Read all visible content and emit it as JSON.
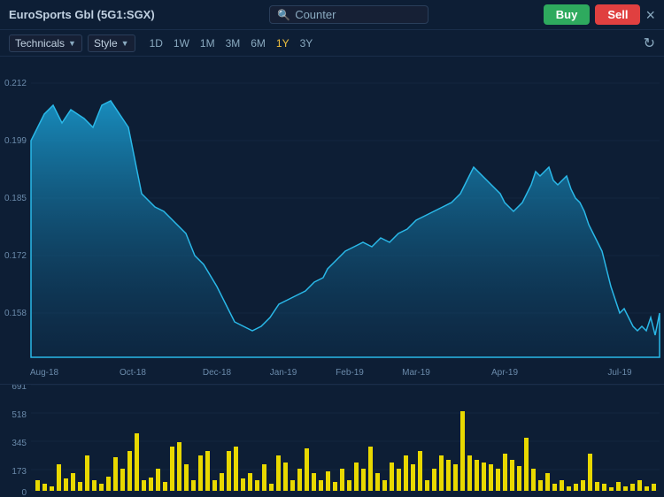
{
  "header": {
    "title": "EuroSports Gbl (5G1:SGX)",
    "search_placeholder": "Counter",
    "buy_label": "Buy",
    "sell_label": "Sell",
    "close_label": "×"
  },
  "toolbar": {
    "technicals_label": "Technicals",
    "style_label": "Style",
    "timeframes": [
      {
        "label": "1D",
        "active": false
      },
      {
        "label": "1W",
        "active": false
      },
      {
        "label": "1M",
        "active": false
      },
      {
        "label": "3M",
        "active": false
      },
      {
        "label": "6M",
        "active": false
      },
      {
        "label": "1Y",
        "active": true
      },
      {
        "label": "3Y",
        "active": false
      }
    ],
    "refresh_icon": "↻"
  },
  "chart": {
    "y_labels": [
      "0.212",
      "0.199",
      "0.185",
      "0.172",
      "0.158"
    ],
    "x_labels": [
      "Aug-18",
      "Oct-18",
      "Dec-18",
      "Jan-19",
      "Feb-19",
      "Mar-19",
      "Apr-19",
      "Jul-19"
    ],
    "volume_y_labels": [
      "691",
      "518",
      "345",
      "173",
      "0"
    ]
  }
}
